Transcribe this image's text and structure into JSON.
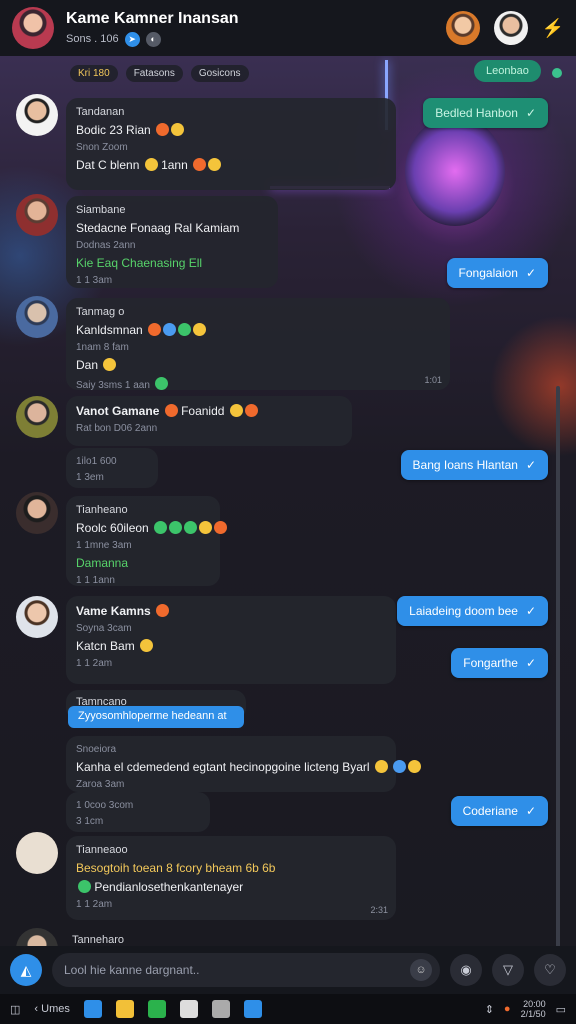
{
  "header": {
    "title": "Kame Kamner Inansan",
    "subtitle": "Sons . 106",
    "menu_icon": "share-icon"
  },
  "top": {
    "chip1": "Kri 180",
    "chip2": "Fatasons",
    "chip3": "Gosicons",
    "badge": "Leonbao"
  },
  "messages": {
    "m1": {
      "name": "Tandanan",
      "line1": "Bodic 23 Rian",
      "muted": "Snon Zoom",
      "line2": "Dat C blenn",
      "line2b": "1ann"
    },
    "out1": "Bedled Hanbon",
    "m2": {
      "name": "Siambane",
      "line1": "Stedacne Fonaag Ral Kamiam",
      "muted": "Dodnas 2ann",
      "link": "Kie Eaq Chaenasing Ell",
      "stamp": "1 1 3am"
    },
    "out2": "Fongalaion",
    "m3": {
      "name": "Tanmag o",
      "line1": "Kanldsmnan",
      "muted": "1nam 8 fam",
      "line2": "Dan",
      "line3": "Saiy 3sms",
      "line3b": "1 aan",
      "stamp": "1:01"
    },
    "m4": {
      "name": "Vanot Gamane",
      "name2": "Foanidd",
      "muted": "Rat bon D06 2ann",
      "muted2": "1ilo1 600",
      "line3": "1 3em"
    },
    "out3": "Bang Ioans Hlantan",
    "m5": {
      "name": "Tianheano",
      "line1": "Roolc 60ileon",
      "muted": "1 1mne 3am",
      "link": "Damanna",
      "stamp": "1 1 1ann"
    },
    "m6": {
      "name": "Vame Kamns",
      "muted": "Soyna 3cam",
      "line1": "Katcn Bam",
      "stamp": "1 1 2am"
    },
    "out4": "Laiadeing doom bee",
    "out5": "Fongarthe",
    "m7": {
      "name": "Tamncano",
      "highlight": "Zyyosomhloperme hedeann at",
      "muted": "Snoeiora",
      "line1": "Kanha el cdemedend egtant hecinopgoine licteng Byarl",
      "muted2": "Zaroa 3am",
      "muted3": "1 0coo 3com",
      "line2": "3 1cm"
    },
    "out6": "Coderiane",
    "m8": {
      "name": "Tianneaoo",
      "line1": "Besogtoih toean 8 fcory bheam 6b 6b",
      "line2": "Pendianlosethenkantenayer",
      "muted": "1 1 2am",
      "stamp": "2:31"
    },
    "m9": {
      "name": "Tanneharo"
    }
  },
  "input": {
    "placeholder": "Lool hie kanne dargnant.."
  },
  "taskbar": {
    "label": "Umes",
    "time": "20:00",
    "date": "2/1/50"
  }
}
